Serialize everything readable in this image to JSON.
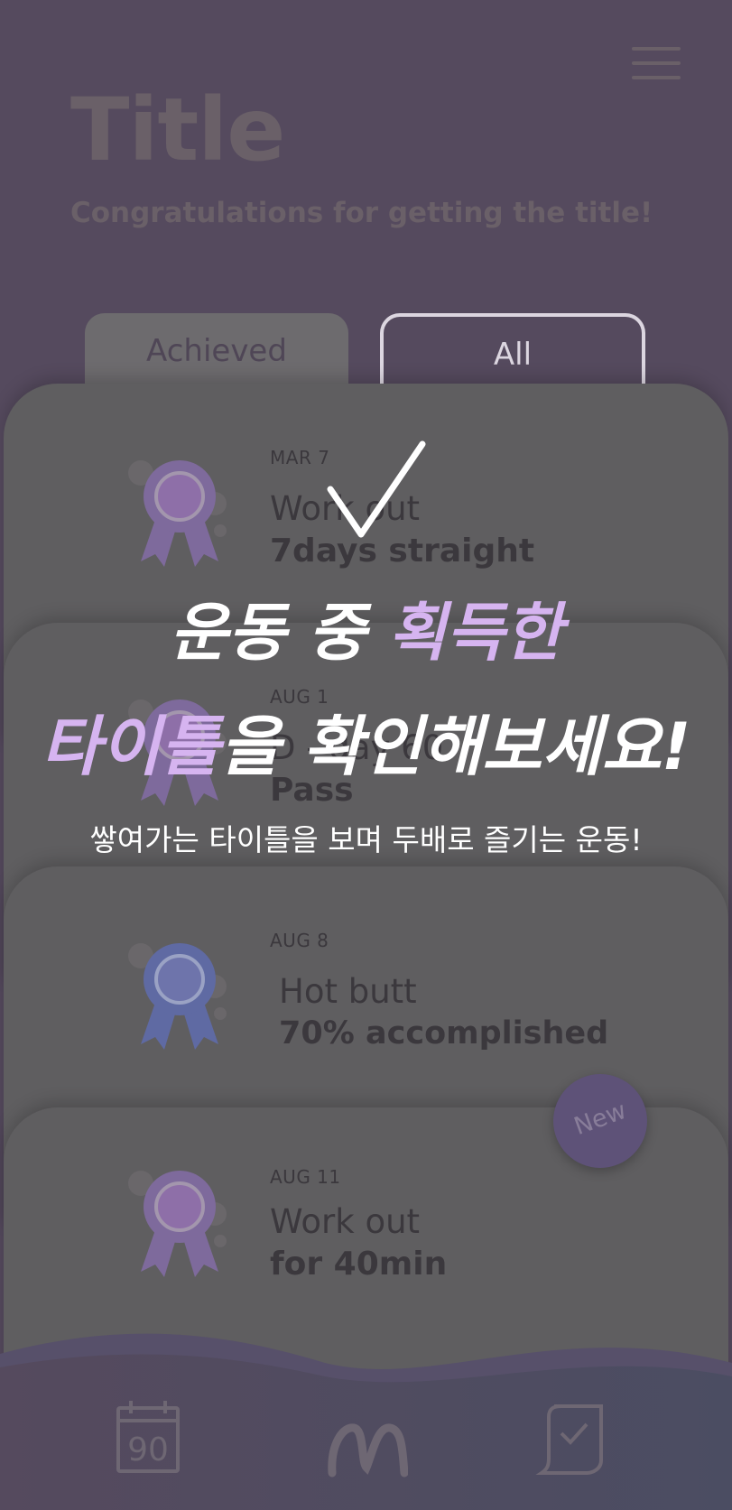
{
  "header": {
    "title": "Title",
    "subtitle": "Congratulations for getting the title!",
    "menu_icon": "hamburger-menu-icon"
  },
  "tabs": [
    {
      "label": "Achieved",
      "selected": true
    },
    {
      "label": "All",
      "selected": false
    }
  ],
  "cards": [
    {
      "date": "MAR 7",
      "name": "Work out",
      "detail": "7days straight",
      "medal_color": "#7e6a9c",
      "medal_icon": "award-ribbon-icon"
    },
    {
      "date": "AUG 1",
      "name": "D - day 60",
      "detail": "Pass",
      "medal_color": "#7e6a9c",
      "medal_icon": "award-ribbon-icon"
    },
    {
      "date": "AUG 8",
      "name": "Hot butt",
      "detail": "70% accomplished",
      "medal_color": "#5f6aa3",
      "medal_icon": "award-ribbon-icon"
    },
    {
      "date": "AUG 11",
      "name": "Work out",
      "detail": "for 40min",
      "medal_color": "#7e6a9c",
      "medal_icon": "award-ribbon-icon"
    }
  ],
  "new_badge": "New",
  "promo": {
    "line1_white": "운동 중 ",
    "line1_lilac": "획득한",
    "line2_lilac": "타이틀",
    "line2_white": "을 확인해보세요!",
    "caption": "쌓여가는 타이틀을 보며 두배로 즐기는 운동!",
    "check_icon": "check-mark-icon"
  },
  "bottom_nav": [
    {
      "label": "90",
      "icon": "calendar-90-icon"
    },
    {
      "icon": "m-logo-icon"
    },
    {
      "icon": "scroll-check-icon"
    }
  ],
  "colors": {
    "background": "#554a5e",
    "card": "#5f5e60",
    "accent": "#d6b4f0",
    "text_dim": "#6a6068"
  }
}
